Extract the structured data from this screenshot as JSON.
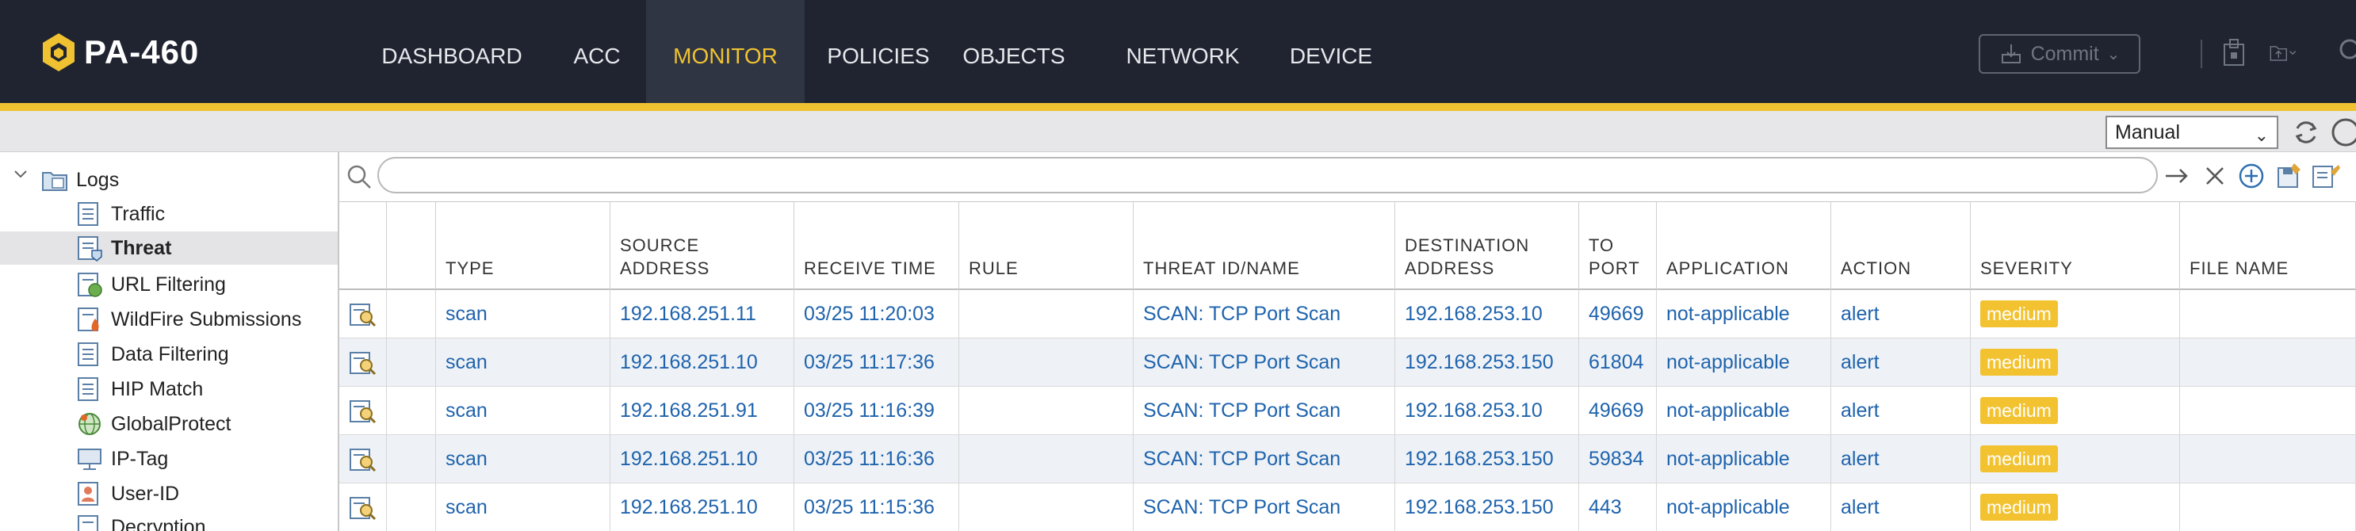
{
  "app": {
    "name": "PA-460"
  },
  "nav": {
    "items": [
      {
        "label": "DASHBOARD"
      },
      {
        "label": "ACC"
      },
      {
        "label": "MONITOR"
      },
      {
        "label": "POLICIES"
      },
      {
        "label": "OBJECTS"
      },
      {
        "label": "NETWORK"
      },
      {
        "label": "DEVICE"
      }
    ],
    "active": "MONITOR",
    "commit_label": "Commit"
  },
  "toolbar": {
    "mode_value": "Manual"
  },
  "sidebar": {
    "root": "Logs",
    "items": [
      {
        "label": "Traffic",
        "icon": "log-file-icon"
      },
      {
        "label": "Threat",
        "icon": "threat-log-icon",
        "selected": true
      },
      {
        "label": "URL Filtering",
        "icon": "url-filter-icon"
      },
      {
        "label": "WildFire Submissions",
        "icon": "wildfire-icon"
      },
      {
        "label": "Data Filtering",
        "icon": "log-file-icon"
      },
      {
        "label": "HIP Match",
        "icon": "log-file-icon"
      },
      {
        "label": "GlobalProtect",
        "icon": "globe-icon"
      },
      {
        "label": "IP-Tag",
        "icon": "monitor-icon"
      },
      {
        "label": "User-ID",
        "icon": "user-id-icon"
      },
      {
        "label": "Decryption",
        "icon": "log-file-icon"
      }
    ]
  },
  "search": {
    "value": "",
    "placeholder": ""
  },
  "table": {
    "columns": [
      {
        "label": ""
      },
      {
        "label": ""
      },
      {
        "label": "TYPE"
      },
      {
        "label": "SOURCE ADDRESS"
      },
      {
        "label": "RECEIVE TIME"
      },
      {
        "label": "RULE"
      },
      {
        "label": "THREAT ID/NAME"
      },
      {
        "label": "DESTINATION ADDRESS"
      },
      {
        "label": "TO PORT"
      },
      {
        "label": "APPLICATION"
      },
      {
        "label": "ACTION"
      },
      {
        "label": "SEVERITY"
      },
      {
        "label": "FILE NAME"
      }
    ],
    "rows": [
      {
        "type": "scan",
        "source": "192.168.251.11",
        "time": "03/25 11:20:03",
        "rule": "",
        "threat": "SCAN: TCP Port Scan",
        "destination": "192.168.253.10",
        "port": "49669",
        "application": "not-applicable",
        "action": "alert",
        "severity": "medium",
        "file": ""
      },
      {
        "type": "scan",
        "source": "192.168.251.10",
        "time": "03/25 11:17:36",
        "rule": "",
        "threat": "SCAN: TCP Port Scan",
        "destination": "192.168.253.150",
        "port": "61804",
        "application": "not-applicable",
        "action": "alert",
        "severity": "medium",
        "file": ""
      },
      {
        "type": "scan",
        "source": "192.168.251.91",
        "time": "03/25 11:16:39",
        "rule": "",
        "threat": "SCAN: TCP Port Scan",
        "destination": "192.168.253.10",
        "port": "49669",
        "application": "not-applicable",
        "action": "alert",
        "severity": "medium",
        "file": ""
      },
      {
        "type": "scan",
        "source": "192.168.251.10",
        "time": "03/25 11:16:36",
        "rule": "",
        "threat": "SCAN: TCP Port Scan",
        "destination": "192.168.253.150",
        "port": "59834",
        "application": "not-applicable",
        "action": "alert",
        "severity": "medium",
        "file": ""
      },
      {
        "type": "scan",
        "source": "192.168.251.10",
        "time": "03/25 11:15:36",
        "rule": "",
        "threat": "SCAN: TCP Port Scan",
        "destination": "192.168.253.150",
        "port": "443",
        "application": "not-applicable",
        "action": "alert",
        "severity": "medium",
        "file": ""
      }
    ]
  },
  "colors": {
    "topbar": "#1f2430",
    "accent": "#f0c232",
    "link": "#1f63ad",
    "severity_medium": "#f2c230",
    "row_alt": "#eef2f6"
  }
}
